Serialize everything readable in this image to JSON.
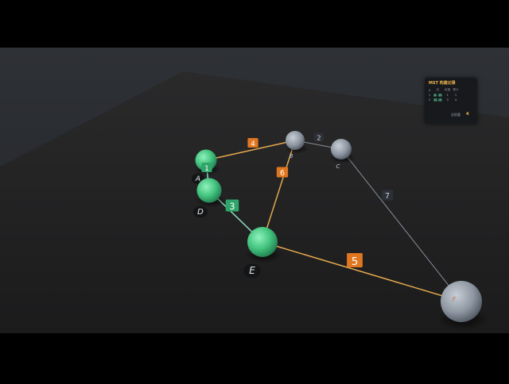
{
  "scene": {
    "colors": {
      "mst_node": "#4fc98c",
      "mst_edge": "#8de0c0",
      "candidate_edge": "#e3a84c",
      "other_edge": "#8a9099",
      "orange_badge": "#e0761f",
      "green_badge": "#2fa56a",
      "gray_badge": "#2c3037",
      "unvisited_node": "#9aa2ad"
    },
    "nodes": [
      {
        "id": "A",
        "label": "A",
        "state": "in-mst"
      },
      {
        "id": "D",
        "label": "D",
        "state": "in-mst"
      },
      {
        "id": "E",
        "label": "E",
        "state": "in-mst"
      },
      {
        "id": "B",
        "label": "B",
        "state": "unvisited"
      },
      {
        "id": "C",
        "label": "C",
        "state": "unvisited"
      },
      {
        "id": "F",
        "label": "F",
        "state": "unvisited"
      }
    ],
    "edges": [
      {
        "from": "A",
        "to": "D",
        "weight": "1",
        "state": "mst"
      },
      {
        "from": "D",
        "to": "E",
        "weight": "3",
        "state": "mst"
      },
      {
        "from": "A",
        "to": "B",
        "weight": "4",
        "state": "candidate"
      },
      {
        "from": "E",
        "to": "B",
        "weight": "6",
        "state": "candidate"
      },
      {
        "from": "E",
        "to": "F",
        "weight": "5",
        "state": "candidate"
      },
      {
        "from": "B",
        "to": "C",
        "weight": "2",
        "state": "other"
      },
      {
        "from": "C",
        "to": "F",
        "weight": "7",
        "state": "other"
      }
    ]
  },
  "panel": {
    "title": "MST 构建记录",
    "headers": [
      "#",
      "边",
      "权重",
      "累计"
    ],
    "rows": [
      {
        "step": "1",
        "u": "A",
        "v": "D",
        "weight": "1",
        "total": "1"
      },
      {
        "step": "2",
        "u": "D",
        "v": "E",
        "weight": "3",
        "total": "4"
      }
    ],
    "total_label": "总权重",
    "total_value": "4"
  }
}
